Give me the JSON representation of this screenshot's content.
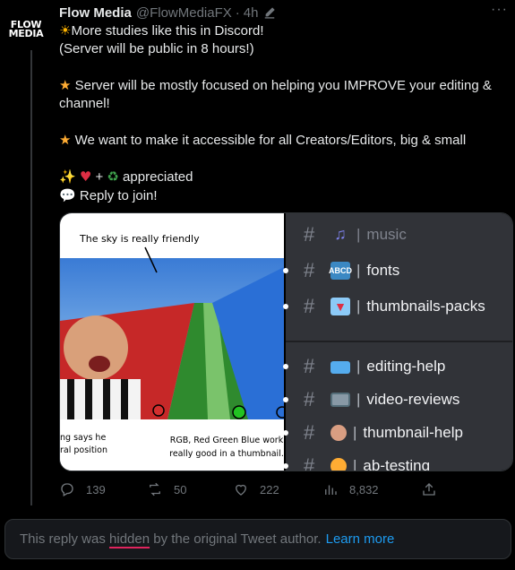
{
  "tweet": {
    "author_name": "Flow Media",
    "handle": "@FlowMediaFX",
    "time": "4h",
    "avatar_text": [
      "FLOW",
      "MEDIA"
    ],
    "lines": {
      "l1": "More studies like this in Discord!",
      "l2": "(Server will be public in 8 hours!)",
      "l3": "Server will be mostly focused on helping you IMPROVE your editing & channel!",
      "l4": "We want to make it accessible for all Creators/Editors, big & small",
      "l5": "+",
      "l5b": "appreciated",
      "l6": "Reply to join!"
    }
  },
  "media": {
    "caption_top": "The sky is really friendly",
    "caption_bottom": "RGB, Red Green Blue work really good in a thumbnail.",
    "caption_cut": "ng says he ral position",
    "channels_top": [
      {
        "name": "music",
        "icon": "music-note-icon",
        "color": "#5865f2"
      },
      {
        "name": "fonts",
        "icon": "abcd-icon",
        "color": "#3b88c3"
      },
      {
        "name": "thumbnails-packs",
        "icon": "inbox-icon",
        "color": "#dd2e44"
      }
    ],
    "channels_bottom": [
      {
        "name": "editing-help",
        "icon": "laptop-icon",
        "color": "#66757f"
      },
      {
        "name": "video-reviews",
        "icon": "tv-icon",
        "color": "#8899a6"
      },
      {
        "name": "thumbnail-help",
        "icon": "palette-icon",
        "color": "#d99e82"
      },
      {
        "name": "ab-testing",
        "icon": "masks-icon",
        "color": "#ffac33"
      }
    ]
  },
  "metrics": {
    "replies": "139",
    "retweets": "50",
    "likes": "222",
    "views": "8,832"
  },
  "hidden_notice": {
    "prefix": "This reply was",
    "hidden": "hidden",
    "suffix": "by the original Tweet author.",
    "link": "Learn more"
  }
}
